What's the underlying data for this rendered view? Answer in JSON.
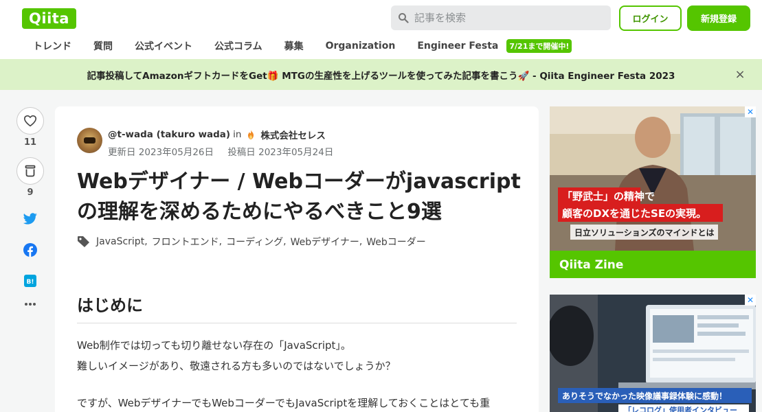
{
  "header": {
    "logo": "Qiita",
    "search_placeholder": "記事を検索",
    "login_label": "ログイン",
    "signup_label": "新規登録"
  },
  "nav": {
    "items": [
      "トレンド",
      "質問",
      "公式イベント",
      "公式コラム",
      "募集",
      "Organization",
      "Engineer Festa"
    ],
    "badge": "7/21まで開催中!"
  },
  "banner": {
    "text": "記事投稿してAmazonギフトカードをGet🎁 MTGの生産性を上げるツールを使ってみた記事を書こう🚀 - Qiita Engineer Festa 2023",
    "close": "×"
  },
  "sidebar": {
    "like_count": "11",
    "stock_count": "9"
  },
  "article": {
    "author": "@t-wada (takuro wada)",
    "in": "in",
    "organization": "株式会社セレス",
    "updated": "更新日 2023年05月26日",
    "posted": "投稿日 2023年05月24日",
    "title": "Webデザイナー / Webコーダーがjavascriptの理解を深めるためにやるべきこと9選",
    "tags": [
      "JavaScript",
      "フロントエンド",
      "コーディング",
      "Webデザイナー",
      "Webコーダー"
    ],
    "heading": "はじめに",
    "paragraphs": [
      "Web制作では切っても切り離せない存在の「JavaScript」。",
      "難しいイメージがあり、敬遠される方も多いのではないでしょうか？",
      "ですが、WebデザイナーでもWebコーダーでもJavaScriptを理解しておくことはとても重"
    ]
  },
  "ads": {
    "ad1": {
      "headline_1": "「野武士」の精神で",
      "headline_2": "顧客のDXを通じたSEの実現。",
      "subline": "日立ソリューションズのマインドとは",
      "brand": "Qiita Zine"
    },
    "ad2": {
      "headline": "ありそうでなかった映像議事録体験に感動！",
      "subline": "「レコログ」使用者インタビュー"
    }
  },
  "colors": {
    "brand": "#55c500",
    "banner_bg": "#dcf2c8",
    "twitter": "#1d9bf0",
    "facebook": "#1877f2",
    "hatena": "#00a4de"
  }
}
